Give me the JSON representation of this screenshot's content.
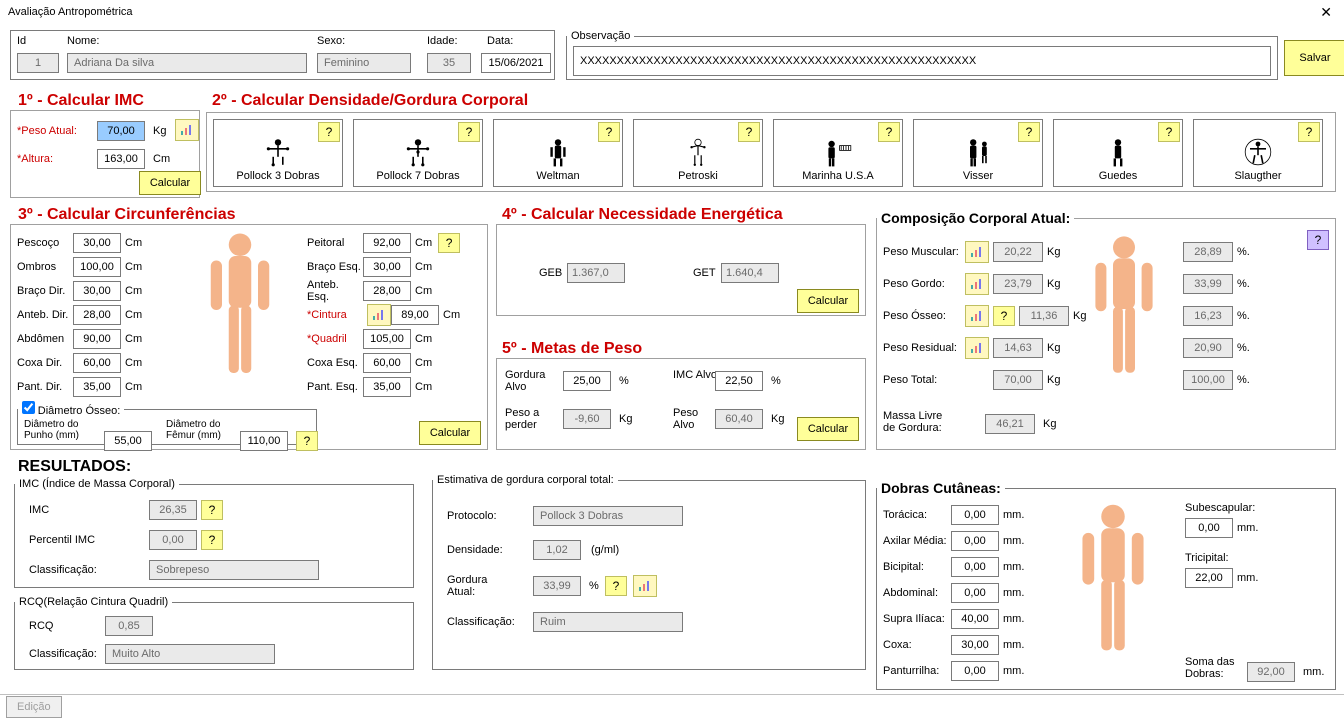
{
  "title": "Avaliação Antropométrica",
  "toprow": {
    "id_label": "Id",
    "id": "1",
    "nome_label": "Nome:",
    "nome": "Adriana Da silva",
    "sexo_label": "Sexo:",
    "sexo": "Feminino",
    "idade_label": "Idade:",
    "idade": "35",
    "data_label": "Data:",
    "data": "15/06/2021",
    "obs_label": "Observação",
    "obs": "XXXXXXXXXXXXXXXXXXXXXXXXXXXXXXXXXXXXXXXXXXXXXXXXXXXXXX",
    "salvar": "Salvar"
  },
  "s1": {
    "title": "1º - Calcular IMC",
    "peso_lbl": "Peso Atual:",
    "peso": "70,00",
    "altura_lbl": "Altura:",
    "altura": "163,00",
    "kg": "Kg",
    "cm": "Cm",
    "calc": "Calcular"
  },
  "s2": {
    "title": "2º -  Calcular Densidade/Gordura Corporal",
    "methods": [
      "Pollock 3 Dobras",
      "Pollock 7 Dobras",
      "Weltman",
      "Petroski",
      "Marinha U.S.A",
      "Visser",
      "Guedes",
      "Slaugther"
    ]
  },
  "s3": {
    "title": "3º - Calcular Circunferências",
    "left": [
      [
        "Pescoço",
        "30,00"
      ],
      [
        "Ombros",
        "100,00"
      ],
      [
        "Braço Dir.",
        "30,00"
      ],
      [
        "Anteb. Dir.",
        "28,00"
      ],
      [
        "Abdômen",
        "90,00"
      ],
      [
        "Coxa Dir.",
        "60,00"
      ],
      [
        "Pant. Dir.",
        "35,00"
      ]
    ],
    "right": [
      [
        "Peitoral",
        "92,00"
      ],
      [
        "Braço Esq.",
        "30,00"
      ],
      [
        "Anteb. Esq.",
        "28,00"
      ],
      [
        "Cintura",
        "89,00"
      ],
      [
        "Quadril",
        "105,00"
      ],
      [
        "Coxa Esq.",
        "60,00"
      ],
      [
        "Pant. Esq.",
        "35,00"
      ]
    ],
    "cm": "Cm",
    "dia_legend": "Diâmetro Ósseo:",
    "punho_lbl": "Diâmetro do Punho (mm)",
    "punho": "55,00",
    "femur_lbl": "Diâmetro do Fêmur (mm)",
    "femur": "110,00",
    "calc": "Calcular"
  },
  "s4": {
    "title": "4º - Calcular Necessidade Energética",
    "geb_lbl": "GEB",
    "geb": "1.367,0",
    "get_lbl": "GET",
    "get": "1.640,4",
    "calc": "Calcular"
  },
  "s5": {
    "title": "5º - Metas de Peso",
    "ga_lbl": "Gordura Alvo",
    "ga": "25,00",
    "pct": "%",
    "ia_lbl": "IMC Alvo",
    "ia": "22,50",
    "pp_lbl": "Peso a perder",
    "pp": "-9,60",
    "kg": "Kg",
    "pa_lbl": "Peso Alvo",
    "pa": "60,40",
    "calc": "Calcular"
  },
  "comp": {
    "title": "Composição Corporal Atual:",
    "rows": [
      [
        "Peso Muscular:",
        "20,22",
        "28,89"
      ],
      [
        "Peso Gordo:",
        "23,79",
        "33,99"
      ],
      [
        "Peso Ósseo:",
        "11,36",
        "16,23"
      ],
      [
        "Peso Residual:",
        "14,63",
        "20,90"
      ],
      [
        "Peso Total:",
        "70,00",
        "100,00"
      ]
    ],
    "mlg_lbl": "Massa Livre de Gordura:",
    "mlg": "46,21",
    "kg": "Kg",
    "pct": "%."
  },
  "res": {
    "title": "RESULTADOS:",
    "imc_legend": "IMC (Índice de Massa Corporal)",
    "imc_lbl": "IMC",
    "imc": "26,35",
    "pimc_lbl": "Percentil IMC",
    "pimc": "0,00",
    "cls_lbl": "Classificação:",
    "cls": "Sobrepeso",
    "rcq_legend": "RCQ(Relação Cintura Quadril)",
    "rcq_lbl": "RCQ",
    "rcq": "0,85",
    "rcq_cls": "Muito Alto"
  },
  "est": {
    "legend": "Estimativa de gordura corporal total:",
    "proto_lbl": "Protocolo:",
    "proto": "Pollock 3 Dobras",
    "dens_lbl": "Densidade:",
    "dens": "1,02",
    "dens_u": "(g/ml)",
    "gatual_lbl": "Gordura Atual:",
    "gatual": "33,99",
    "pct": "%",
    "cls_lbl": "Classificação:",
    "cls": "Ruim"
  },
  "dobras": {
    "title": "Dobras Cutâneas:",
    "left": [
      [
        "Torácica:",
        "0,00"
      ],
      [
        "Axilar Média:",
        "0,00"
      ],
      [
        "Bicipital:",
        "0,00"
      ],
      [
        "Abdominal:",
        "0,00"
      ],
      [
        "Supra Ilíaca:",
        "40,00"
      ],
      [
        "Coxa:",
        "30,00"
      ],
      [
        "Panturrilha:",
        "0,00"
      ]
    ],
    "right": [
      [
        "Subescapular:",
        "0,00"
      ],
      [
        "Tricipital:",
        "22,00"
      ]
    ],
    "soma_lbl": "Soma das Dobras:",
    "soma": "92,00",
    "mm": "mm."
  },
  "footer": {
    "edit": "Edição"
  }
}
